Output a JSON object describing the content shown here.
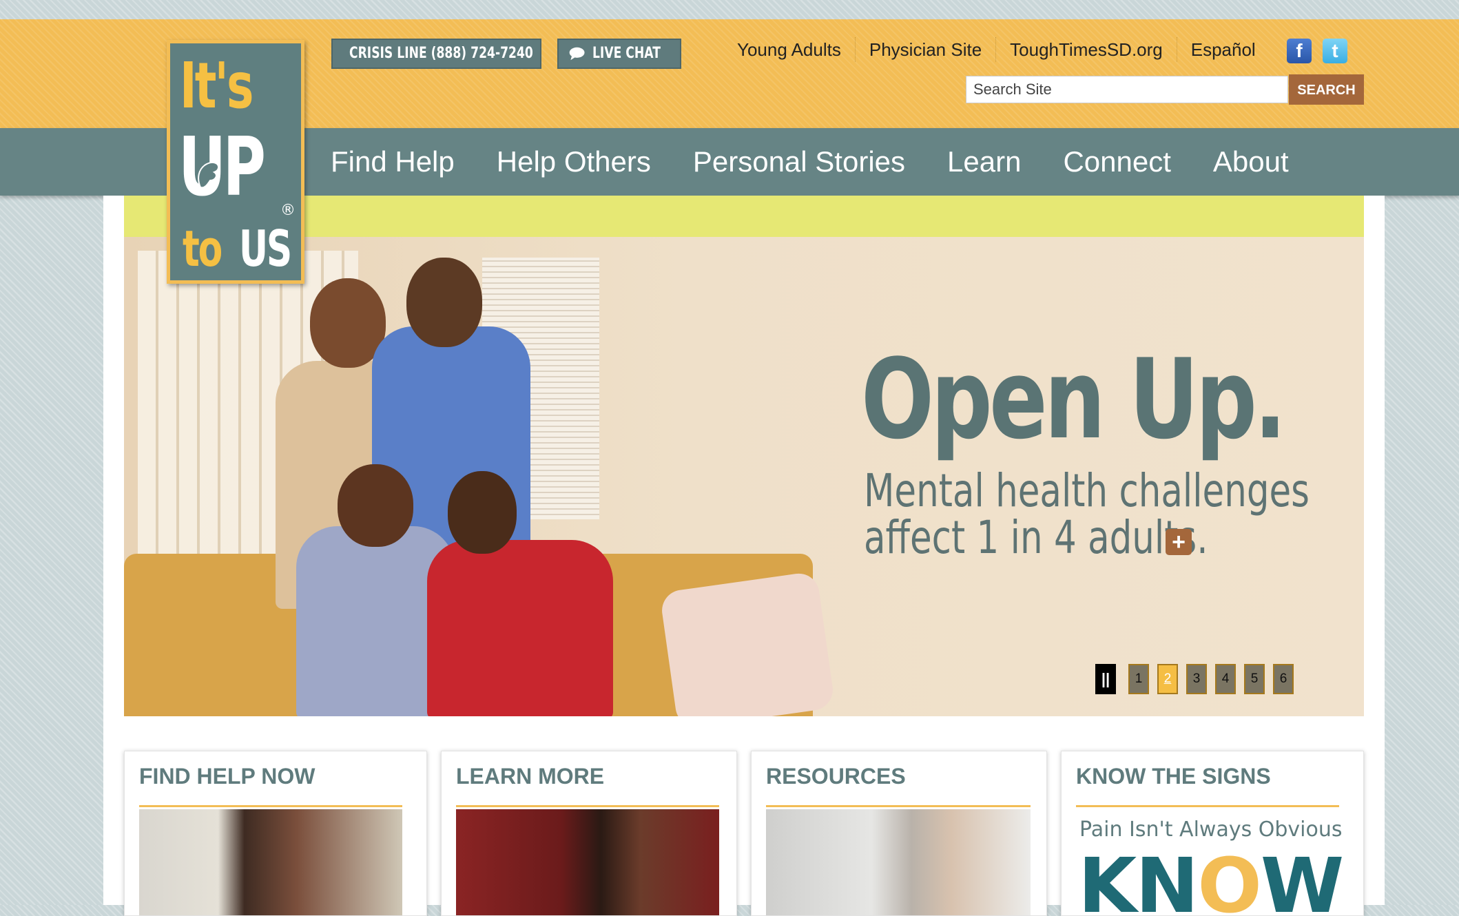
{
  "header": {
    "logo": {
      "line1": "It's",
      "line2": "UP",
      "line3a": "to",
      "line3b": "US",
      "registered": "®"
    },
    "crisis_line": "CRISIS LINE (888) 724-7240",
    "live_chat": "LIVE CHAT",
    "links": [
      "Young Adults",
      "Physician Site",
      "ToughTimesSD.org",
      "Español"
    ],
    "social": {
      "facebook": "f",
      "twitter": "t"
    },
    "search": {
      "placeholder": "Search Site",
      "button": "SEARCH"
    }
  },
  "nav": {
    "items": [
      "Find Help",
      "Help Others",
      "Personal Stories",
      "Learn",
      "Connect",
      "About"
    ]
  },
  "hero": {
    "headline": "Open Up.",
    "sub_line1": "Mental health challenges",
    "sub_line2": "affect 1 in 4 adults.",
    "more_icon": "+",
    "pause_label": "||",
    "slides": [
      "1",
      "2",
      "3",
      "4",
      "5",
      "6"
    ],
    "active_slide": "2"
  },
  "cards": [
    {
      "title": "FIND HELP NOW"
    },
    {
      "title": "LEARN MORE"
    },
    {
      "title": "RESOURCES"
    },
    {
      "title": "KNOW THE SIGNS",
      "tagline": "Pain Isn't Always Obvious",
      "logo_text_a": "KN",
      "logo_text_o": "O",
      "logo_text_b": "W"
    }
  ],
  "colors": {
    "accent_orange": "#f3bd55",
    "nav_teal": "#668485",
    "brown_button": "#a4673b",
    "highlight_yellow": "#e6e874"
  }
}
